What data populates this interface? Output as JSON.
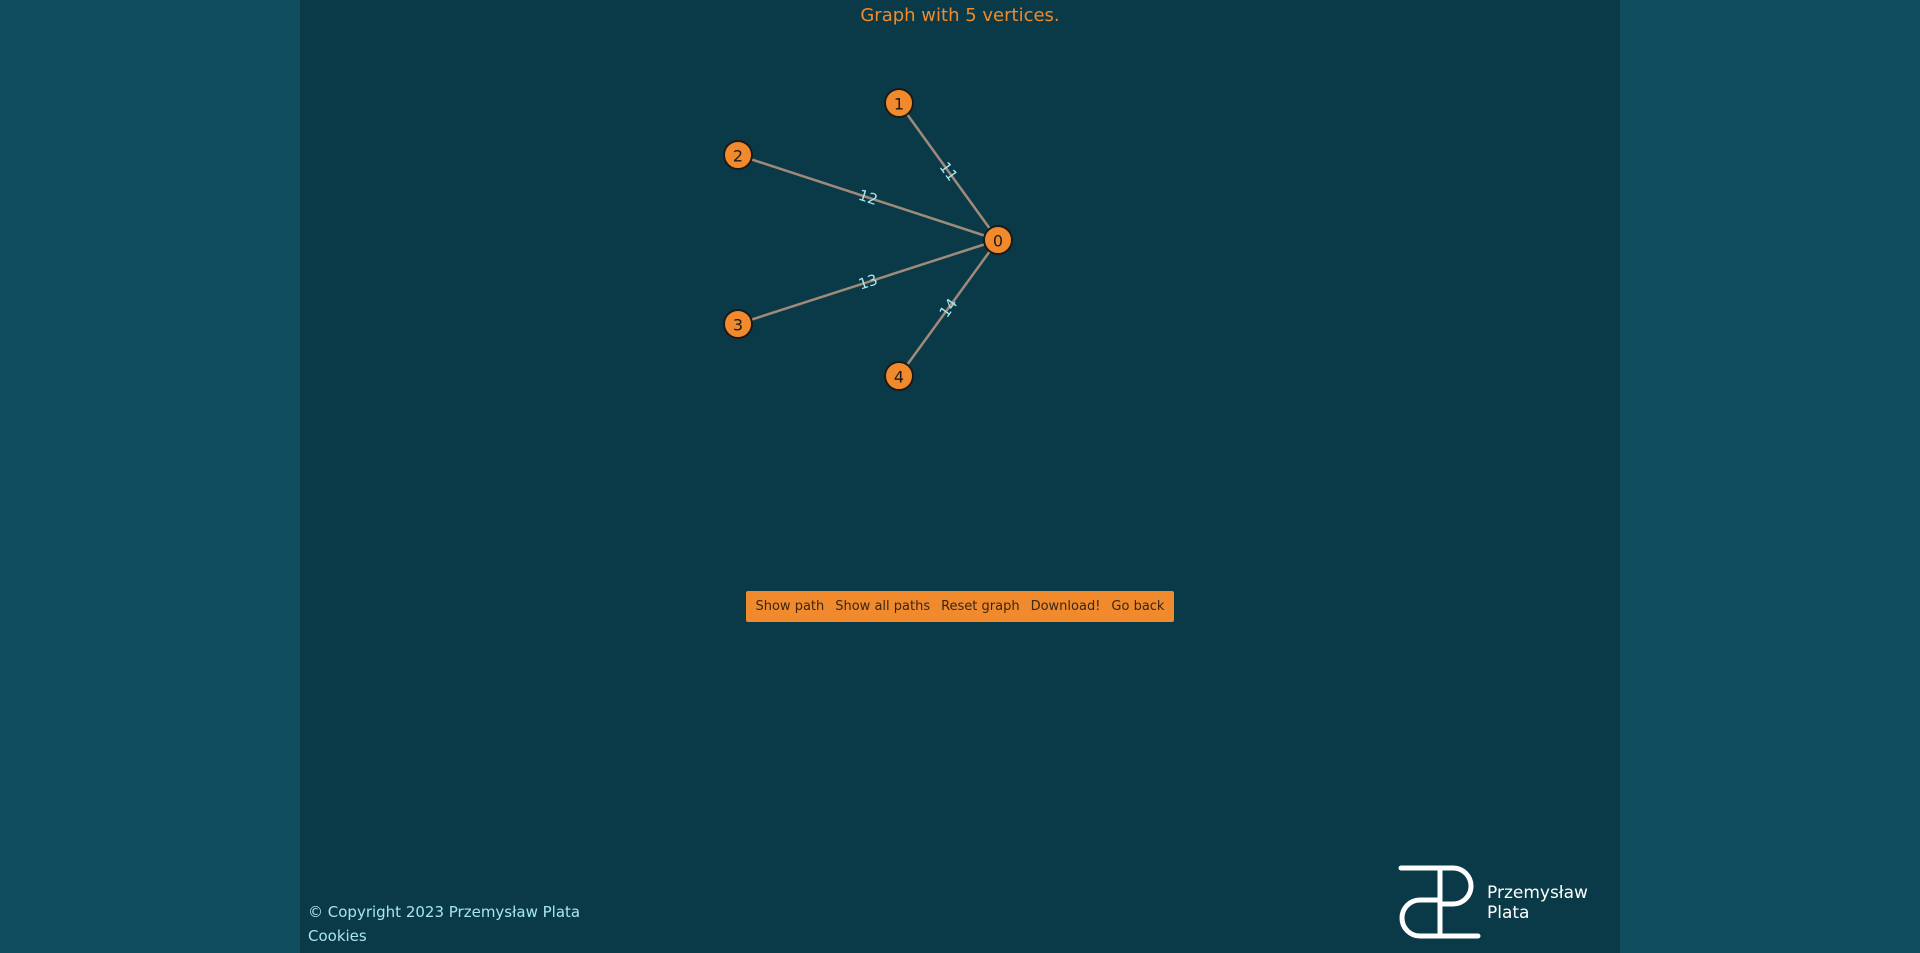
{
  "page": {
    "title": "Graph with 5 vertices."
  },
  "graph": {
    "vertices": [
      {
        "id": "0",
        "label": "0"
      },
      {
        "id": "1",
        "label": "1"
      },
      {
        "id": "2",
        "label": "2"
      },
      {
        "id": "3",
        "label": "3"
      },
      {
        "id": "4",
        "label": "4"
      }
    ],
    "edges": [
      {
        "from": "1",
        "to": "0",
        "weight": "11"
      },
      {
        "from": "2",
        "to": "0",
        "weight": "12"
      },
      {
        "from": "3",
        "to": "0",
        "weight": "13"
      },
      {
        "from": "4",
        "to": "0",
        "weight": "14"
      }
    ]
  },
  "toolbar": {
    "show_path": "Show path",
    "show_all_paths": "Show all paths",
    "reset_graph": "Reset graph",
    "download": "Download!",
    "go_back": "Go back"
  },
  "footer": {
    "copyright": "© Copyright 2023 Przemysław Plata",
    "cookies": "Cookies",
    "logo_line1": "Przemysław",
    "logo_line2": "Plata"
  },
  "colors": {
    "page_bg": "#0f4c5e",
    "content_bg": "#0a3a48",
    "accent": "#f08a2c",
    "edge": "#a08a7a",
    "weight_text": "#a8e6ef"
  }
}
